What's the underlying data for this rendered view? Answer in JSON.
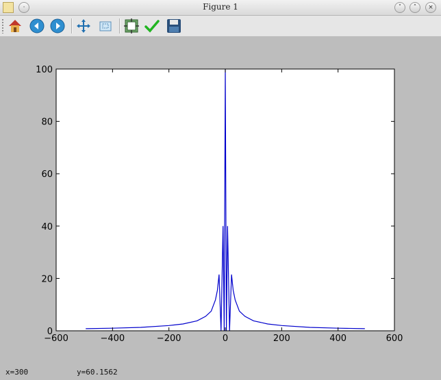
{
  "window": {
    "title": "Figure 1"
  },
  "toolbar": {
    "tools": [
      "home-icon",
      "back-icon",
      "forward-icon",
      "pan-icon",
      "zoom-icon",
      "subplots-icon",
      "edit-icon",
      "save-icon"
    ]
  },
  "status": {
    "x_readout": "x=300",
    "y_readout": "y=60.1562"
  },
  "chart_data": {
    "type": "line",
    "xlim": [
      -600,
      600
    ],
    "ylim": [
      0,
      100
    ],
    "x_ticks": [
      "−600",
      "−400",
      "−200",
      "0",
      "200",
      "400",
      "600"
    ],
    "y_ticks": [
      "0",
      "20",
      "40",
      "60",
      "80",
      "100"
    ],
    "series": [
      {
        "color": "#0000cc",
        "x": [
          -495,
          -400,
          -300,
          -200,
          -150,
          -100,
          -70,
          -50,
          -35,
          -28,
          -22,
          -15,
          -8,
          -4,
          0,
          4,
          8,
          15,
          22,
          28,
          35,
          50,
          70,
          100,
          150,
          200,
          300,
          400,
          495
        ],
        "y": [
          0.8,
          1.0,
          1.3,
          2.0,
          2.6,
          3.8,
          5.5,
          7.5,
          11.8,
          15.5,
          21.5,
          0.0,
          40.0,
          0.0,
          100.0,
          0.0,
          40.0,
          0.0,
          21.5,
          15.5,
          11.8,
          7.5,
          5.5,
          3.8,
          2.6,
          2.0,
          1.3,
          1.0,
          0.8
        ]
      }
    ]
  }
}
